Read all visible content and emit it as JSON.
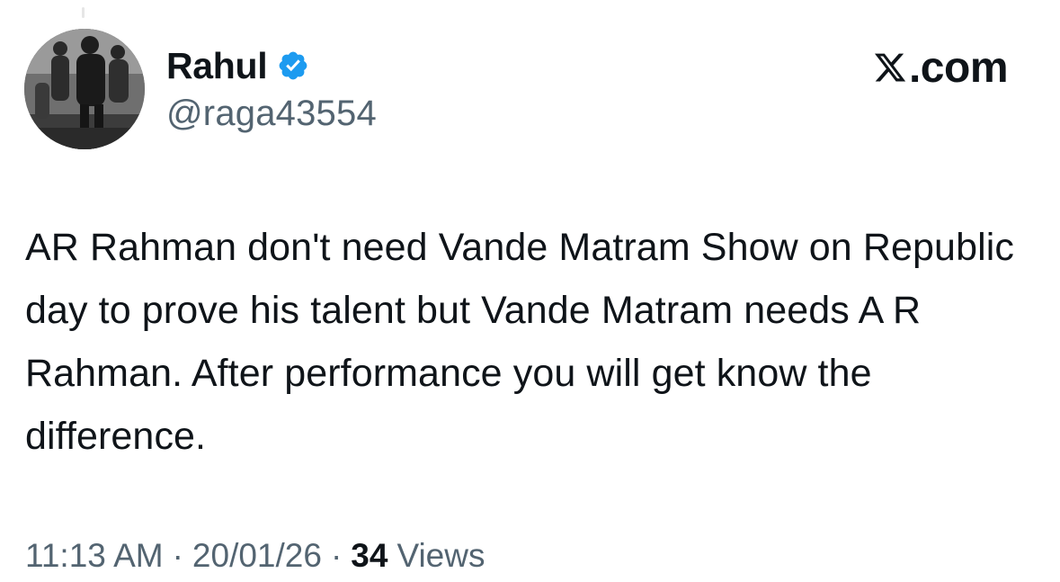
{
  "author": {
    "display_name": "Rahul",
    "handle": "@raga43554",
    "verified": true,
    "verified_color": "#1d9bf0",
    "avatar": "monochrome-photo-avatar"
  },
  "brand": {
    "logo": "x-logo-icon",
    "label": ".com"
  },
  "tweet": {
    "text": "AR Rahman don't need Vande Matram Show on Republic day to prove his talent but Vande Matram needs A R Rahman. After performance you will get know the difference."
  },
  "meta": {
    "time": "11:13 AM",
    "date": "20/01/26",
    "separator": "·",
    "views_count": "34",
    "views_label": "Views"
  },
  "colors": {
    "text_primary": "#0f1419",
    "text_secondary": "#536471",
    "background": "#ffffff"
  }
}
